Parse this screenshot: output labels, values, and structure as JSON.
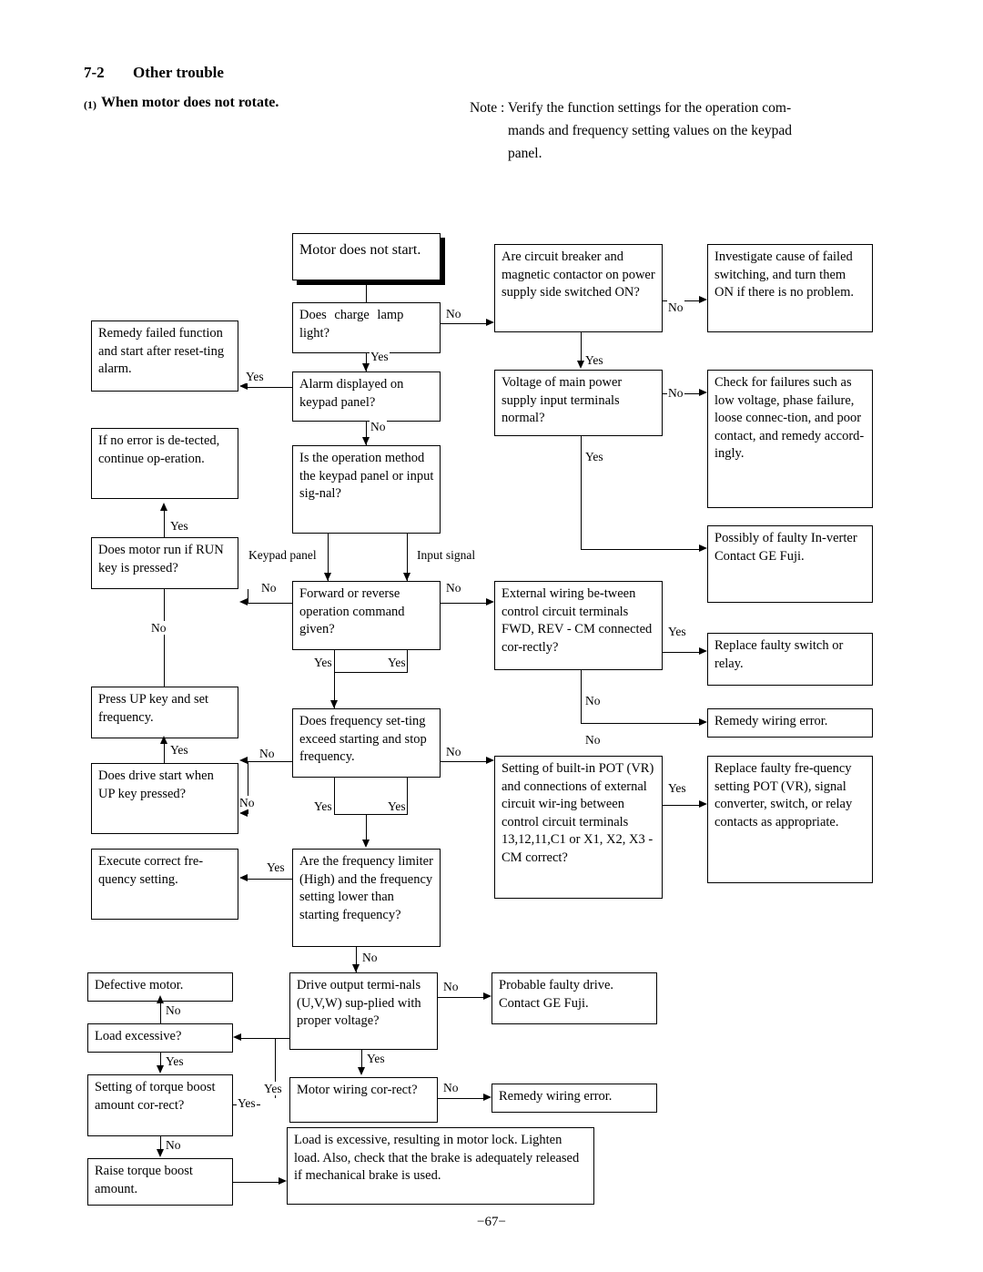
{
  "header": {
    "section_number": "7-2",
    "section_title": "Other trouble",
    "sub_number": "(1)",
    "sub_title": "When motor does not rotate."
  },
  "note": {
    "line1": "Note : Verify the function settings for the operation com-",
    "line2": "mands and frequency setting values on the keypad",
    "line3": "panel."
  },
  "page_number": "−67−",
  "flow": {
    "boxes": {
      "start": "Motor does not start.",
      "charge_lamp": "Does charge lamp light?",
      "alarm_displayed": "Alarm displayed on keypad panel?",
      "operation_method": "Is the operation method the keypad panel or input sig-nal?",
      "fwd_rev": "Forward or reverse operation command given?",
      "freq_setting": "Does frequency set-ting exceed starting and stop frequency.",
      "freq_limiter": "Are the frequency limiter (High) and the frequency setting lower than starting frequency?",
      "drive_output": "Drive output termi-nals (U,V,W) sup-plied with proper voltage?",
      "motor_wiring": "Motor wiring cor-rect?",
      "breaker": "Are circuit breaker and magnetic contactor on power supply side switched ON?",
      "voltage_main": "Voltage of main power supply input terminals normal?",
      "external_wiring": "External wiring be-tween control circuit terminals FWD, REV - CM connected cor-rectly?",
      "built_in_pot": "Setting of built-in POT (VR) and connections of external circuit wir-ing between control circuit terminals 13,12,11,C1 or X1, X2, X3 - CM correct?",
      "investigate": "Investigate cause of failed switching, and turn them ON if there is no problem.",
      "check_failures": "Check for failures such as low voltage, phase failure, loose connec-tion, and poor contact, and remedy accord-ingly.",
      "faulty_inverter": "Possibly of faulty In-verter  Contact GE Fuji.",
      "replace_switch": "Replace faulty switch or relay.",
      "remedy_wiring1": "Remedy wiring error.",
      "replace_pot": "Replace faulty fre-quency setting POT (VR), signal converter, switch, or relay contacts as appropriate.",
      "probable_faulty_drive": "Probable faulty drive. Contact GE Fuji.",
      "remedy_wiring2": "Remedy wiring error.",
      "remedy_failed": "Remedy failed function and start after reset-ting alarm.",
      "no_error": "If no error is de-tected, continue op-eration.",
      "motor_run_run_key": "Does motor run if RUN key is pressed?",
      "press_up_key": "Press UP key and set frequency.",
      "drive_start_up": "Does drive start when UP key pressed?",
      "execute_correct": "Execute correct fre-quency setting.",
      "defective_motor": "Defective motor.",
      "load_excessive": "Load excessive?",
      "torque_boost": "Setting of torque boost amount cor-rect?",
      "raise_torque": "Raise torque boost amount.",
      "load_lock": "Load is excessive, resulting in motor lock. Lighten load.  Also, check that the brake is adequately released if mechanical brake is used."
    },
    "labels": {
      "no": "No",
      "yes": "Yes",
      "keypad_panel": "Keypad panel",
      "input_signal": "Input signal"
    }
  }
}
